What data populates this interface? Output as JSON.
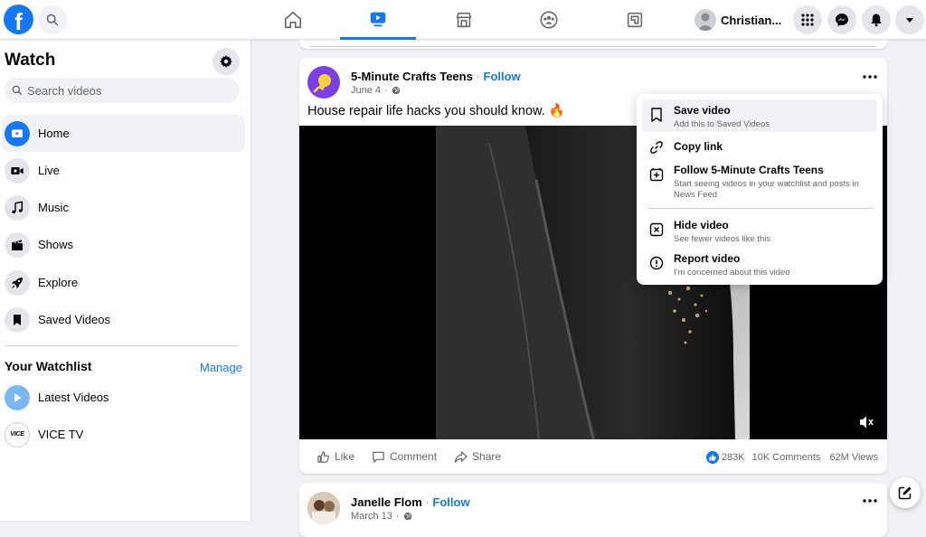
{
  "topbar": {
    "logo_letter": "f",
    "profile_name": "Christian..."
  },
  "sidebar": {
    "title": "Watch",
    "search_placeholder": "Search videos",
    "items": [
      {
        "label": "Home",
        "icon": "watch-home-icon"
      },
      {
        "label": "Live",
        "icon": "live-video-icon"
      },
      {
        "label": "Music",
        "icon": "music-note-icon"
      },
      {
        "label": "Shows",
        "icon": "clapperboard-icon"
      },
      {
        "label": "Explore",
        "icon": "rocket-icon"
      },
      {
        "label": "Saved Videos",
        "icon": "bookmark-icon"
      }
    ],
    "watchlist_title": "Your Watchlist",
    "manage_label": "Manage",
    "watchlist": [
      {
        "label": "Latest Videos",
        "icon": "play-circle-icon"
      },
      {
        "label": "VICE TV",
        "icon": "vice-logo",
        "logo_text": "VICE"
      }
    ]
  },
  "post": {
    "author": "5-Minute Crafts Teens",
    "follow_label": "Follow",
    "date": "June 4",
    "caption": "House repair life hacks you should know. 🔥",
    "actions": {
      "like": "Like",
      "comment": "Comment",
      "share": "Share"
    },
    "stats": {
      "reactions": "283K",
      "comments": "10K Comments",
      "views": "62M Views"
    }
  },
  "menu": {
    "items": [
      {
        "title": "Save video",
        "subtitle": "Add this to Saved Videos",
        "icon": "bookmark-icon"
      },
      {
        "title": "Copy link",
        "subtitle": "",
        "icon": "link-icon"
      },
      {
        "title": "Follow 5-Minute Crafts Teens",
        "subtitle": "Start seeing videos in your watchlist and posts in News Feed",
        "icon": "add-box-icon"
      },
      {
        "title": "Hide video",
        "subtitle": "See fewer videos like this",
        "icon": "close-box-icon"
      },
      {
        "title": "Report video",
        "subtitle": "I'm concerned about this video",
        "icon": "alert-circle-icon"
      }
    ]
  },
  "post2": {
    "author": "Janelle Flom",
    "follow_label": "Follow",
    "date": "March 13"
  },
  "colors": {
    "accent": "#1877f2",
    "background": "#f0f2f5"
  }
}
